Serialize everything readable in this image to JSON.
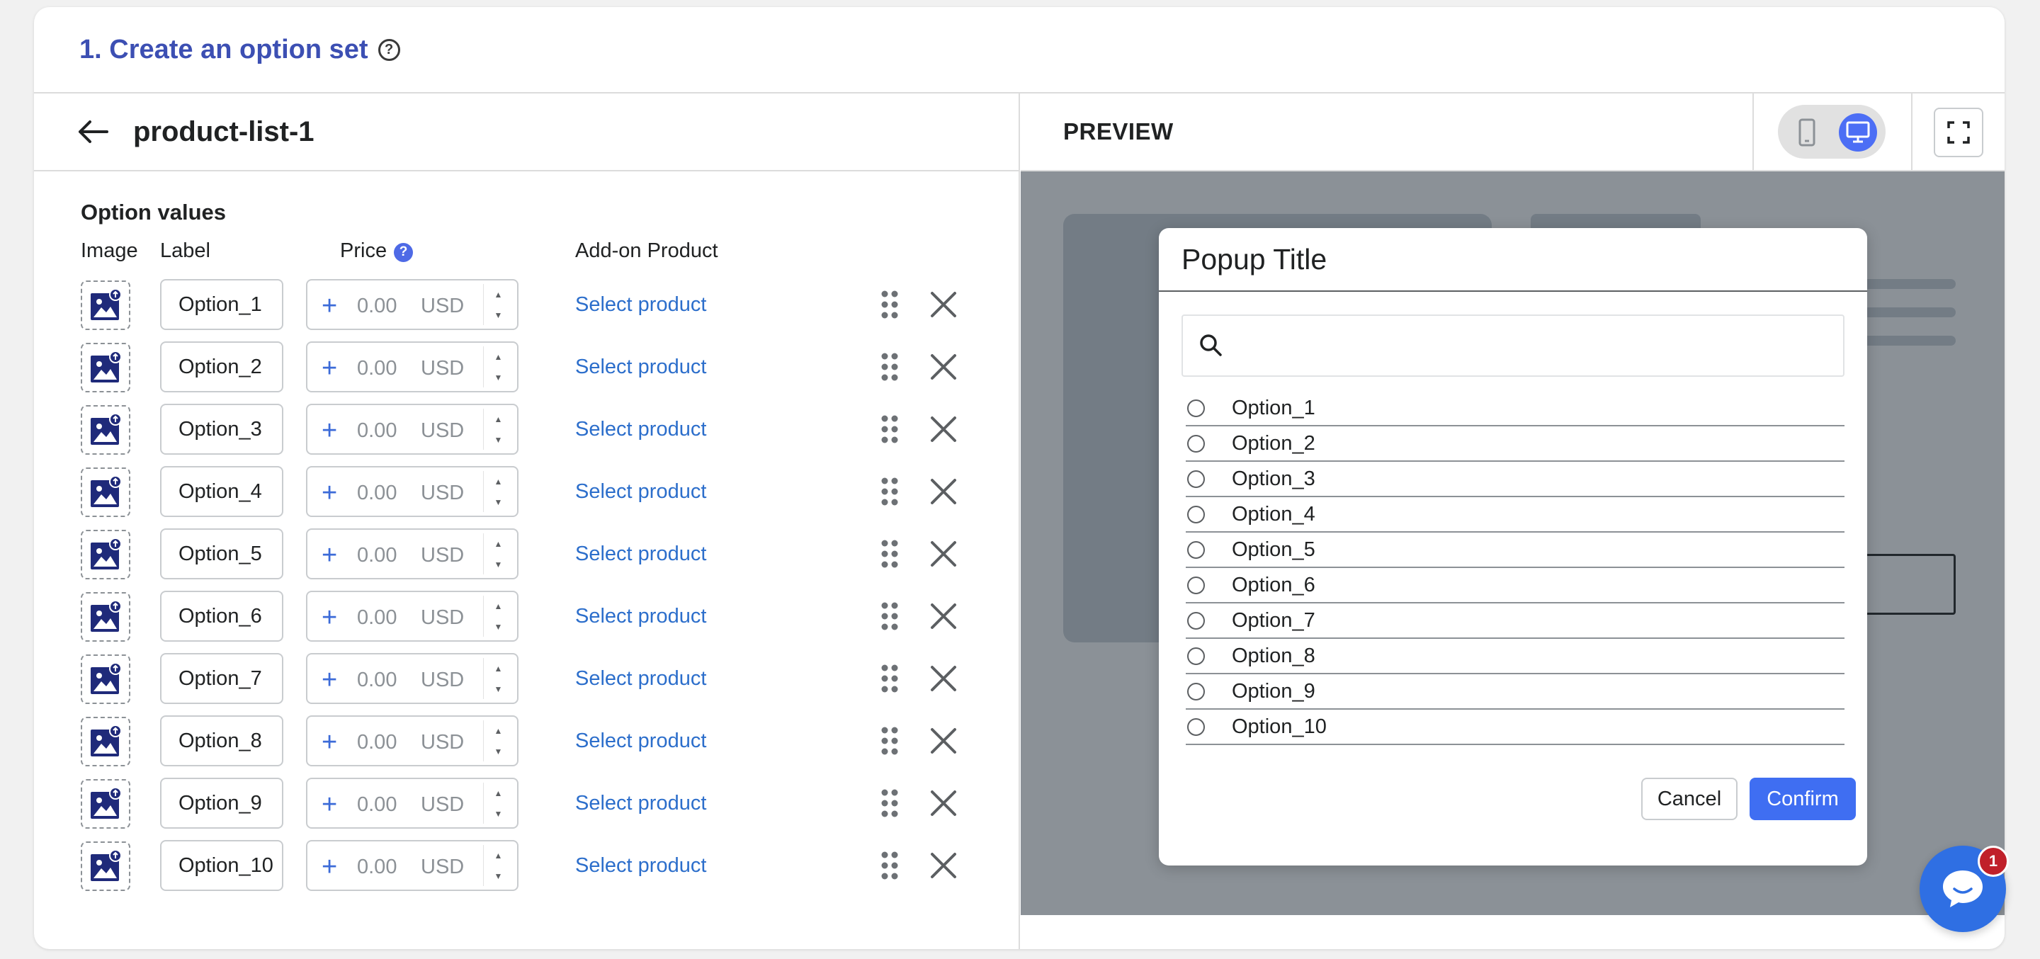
{
  "header": {
    "title": "1. Create an option set",
    "help_icon": "?"
  },
  "editor": {
    "title": "product-list-1",
    "section_title": "Option values",
    "columns": {
      "image": "Image",
      "label": "Label",
      "price": "Price",
      "price_help": "?",
      "addon": "Add-on Product"
    },
    "rows": [
      {
        "label": "Option_1",
        "price": "0.00",
        "currency": "USD",
        "addon": "Select product"
      },
      {
        "label": "Option_2",
        "price": "0.00",
        "currency": "USD",
        "addon": "Select product"
      },
      {
        "label": "Option_3",
        "price": "0.00",
        "currency": "USD",
        "addon": "Select product"
      },
      {
        "label": "Option_4",
        "price": "0.00",
        "currency": "USD",
        "addon": "Select product"
      },
      {
        "label": "Option_5",
        "price": "0.00",
        "currency": "USD",
        "addon": "Select product"
      },
      {
        "label": "Option_6",
        "price": "0.00",
        "currency": "USD",
        "addon": "Select product"
      },
      {
        "label": "Option_7",
        "price": "0.00",
        "currency": "USD",
        "addon": "Select product"
      },
      {
        "label": "Option_8",
        "price": "0.00",
        "currency": "USD",
        "addon": "Select product"
      },
      {
        "label": "Option_9",
        "price": "0.00",
        "currency": "USD",
        "addon": "Select product"
      },
      {
        "label": "Option_10",
        "price": "0.00",
        "currency": "USD",
        "addon": "Select product"
      }
    ]
  },
  "preview": {
    "title": "PREVIEW",
    "device_selected": "desktop",
    "modal": {
      "title": "Popup Title",
      "options": [
        "Option_1",
        "Option_2",
        "Option_3",
        "Option_4",
        "Option_5",
        "Option_6",
        "Option_7",
        "Option_8",
        "Option_9",
        "Option_10"
      ],
      "cancel": "Cancel",
      "confirm": "Confirm"
    }
  },
  "chat": {
    "badge": "1"
  },
  "colors": {
    "accent": "#3c4fb3",
    "link": "#2c6ecb",
    "primary_button": "#3f6ef2",
    "badge": "#c0202a"
  }
}
